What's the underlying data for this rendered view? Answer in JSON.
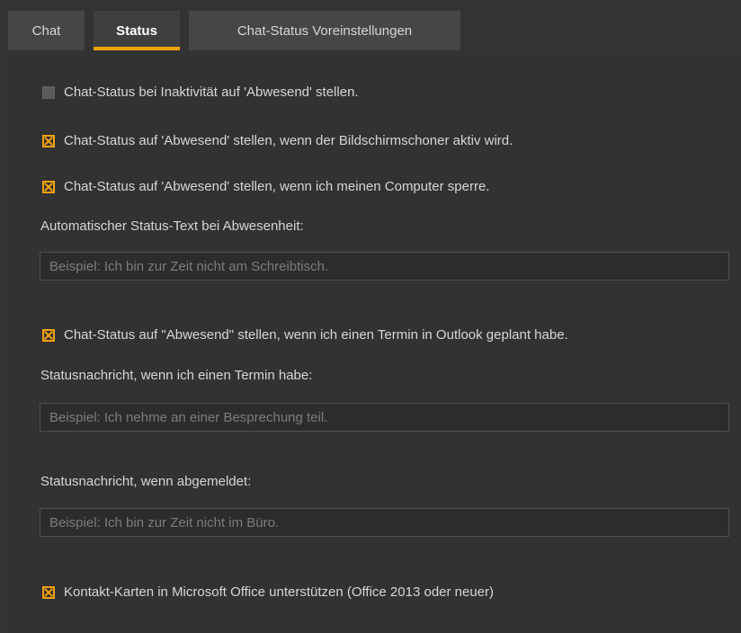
{
  "tabs": [
    {
      "label": "Chat",
      "active": false
    },
    {
      "label": "Status",
      "active": true
    },
    {
      "label": "Chat-Status Voreinstellungen",
      "active": false
    }
  ],
  "accent_color": "#f2a20e",
  "options": {
    "inactivity": {
      "label": "Chat-Status bei Inaktivität auf 'Abwesend' stellen.",
      "checked": false
    },
    "screensaver": {
      "label": "Chat-Status auf 'Abwesend' stellen, wenn der Bildschirmschoner aktiv wird.",
      "checked": true
    },
    "lock": {
      "label": "Chat-Status auf 'Abwesend' stellen, wenn ich meinen Computer sperre.",
      "checked": true
    },
    "outlook": {
      "label": "Chat-Status auf \"Abwesend\" stellen, wenn ich einen Termin in Outlook geplant habe.",
      "checked": true
    },
    "contact_cards": {
      "label": "Kontakt-Karten in Microsoft Office unterstützen (Office 2013 oder neuer)",
      "checked": true
    }
  },
  "away_text": {
    "label": "Automatischer Status-Text bei Abwesenheit:",
    "value": "",
    "placeholder": "Beispiel: Ich bin zur Zeit nicht am Schreibtisch."
  },
  "meeting_text": {
    "label": "Statusnachricht, wenn ich einen Termin habe:",
    "value": "",
    "placeholder": "Beispiel: Ich nehme an einer Besprechung teil."
  },
  "logoff_text": {
    "label": "Statusnachricht, wenn abgemeldet:",
    "value": "",
    "placeholder": "Beispiel: Ich bin zur Zeit nicht im Büro."
  }
}
